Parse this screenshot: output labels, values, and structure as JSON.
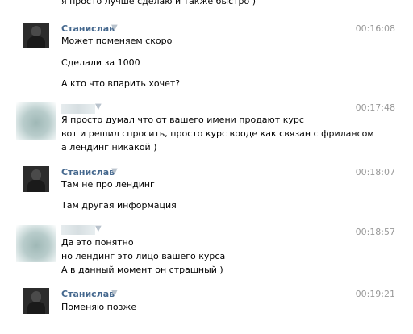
{
  "chat": {
    "top_fragment": "я просто лучше сделаю и также быстро )",
    "messages": [
      {
        "author": "Станислав",
        "time": "00:16:08",
        "lines": [
          "Может поменяем скоро",
          "Сделали за 1000",
          "А кто что впарить хочет?"
        ]
      },
      {
        "author": "",
        "time": "00:17:48",
        "lines": [
          "Я просто думал что от вашего имени продают курс",
          "вот и решил спросить, просто курс вроде как связан с фрилансом",
          "а лендинг никакой )"
        ]
      },
      {
        "author": "Станислав",
        "time": "00:18:07",
        "lines": [
          "Там не про лендинг",
          "Там другая информация"
        ]
      },
      {
        "author": "",
        "time": "00:18:57",
        "lines": [
          "Да это понятно",
          "но лендинг это лицо вашего курса",
          "А в данный момент он страшный )"
        ]
      },
      {
        "author": "Станислав",
        "time": "00:19:21",
        "lines": [
          "Поменяю позже"
        ]
      }
    ],
    "author_caret": "▼"
  }
}
